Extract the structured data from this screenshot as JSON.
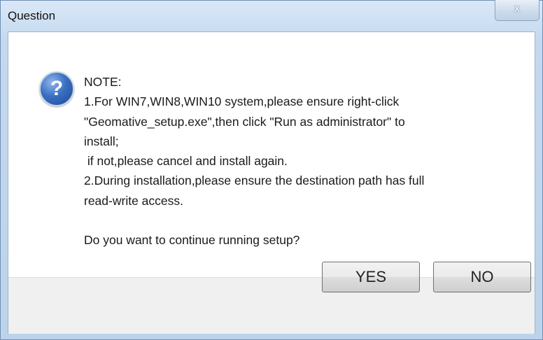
{
  "window": {
    "title": "Question",
    "close_label": "x"
  },
  "icon": {
    "name": "question-icon",
    "glyph": "?"
  },
  "message": {
    "lines": [
      "NOTE:",
      "1.For WIN7,WIN8,WIN10 system,please ensure right-click",
      "\"Geomative_setup.exe\",then click \"Run as administrator\" to",
      "install;",
      " if not,please cancel and install again.",
      "2.During installation,please ensure the destination path has full",
      "read-write access.",
      "",
      "Do you want to continue running setup?"
    ]
  },
  "buttons": {
    "yes_label": "YES",
    "no_label": "NO"
  }
}
